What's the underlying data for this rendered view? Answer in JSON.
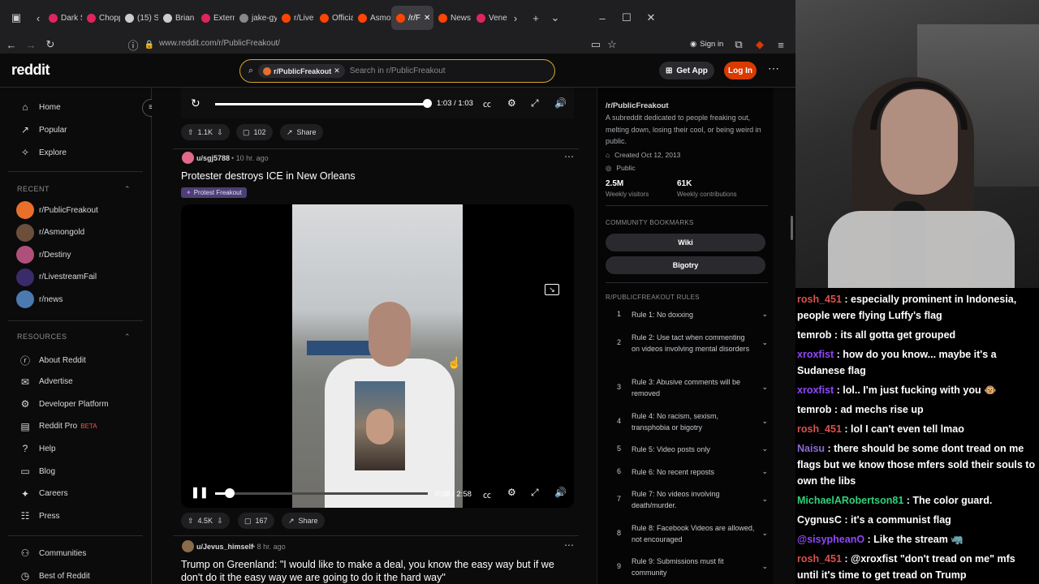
{
  "browser": {
    "tabs": [
      {
        "label": "Dark S",
        "color": "#e0245e"
      },
      {
        "label": "Chopp",
        "color": "#e0245e"
      },
      {
        "label": "(15) S",
        "color": "#cccccc"
      },
      {
        "label": "Brian",
        "color": "#cccccc"
      },
      {
        "label": "Extern",
        "color": "#e0245e"
      },
      {
        "label": "jake-gylle",
        "color": "#888888"
      },
      {
        "label": "r/Live",
        "color": "#ff4500"
      },
      {
        "label": "Officia",
        "color": "#ff4500"
      },
      {
        "label": "Asmo",
        "color": "#ff4500"
      },
      {
        "label": "/r/F",
        "color": "#ff4500"
      },
      {
        "label": "News",
        "color": "#ff4500"
      },
      {
        "label": "Vene",
        "color": "#e0245e"
      }
    ],
    "url": "www.reddit.com/r/PublicFreakout/",
    "sign_in": "Sign in"
  },
  "header": {
    "logo": "reddit",
    "search_chip": "r/PublicFreakout",
    "search_placeholder": "Search in r/PublicFreakout",
    "get_app": "Get App",
    "log_in": "Log In"
  },
  "sidebar": {
    "nav": [
      {
        "label": "Home",
        "icon": "home-icon"
      },
      {
        "label": "Popular",
        "icon": "popular-icon"
      },
      {
        "label": "Explore",
        "icon": "explore-icon"
      }
    ],
    "recent_title": "RECENT",
    "recent": [
      {
        "label": "r/PublicFreakout",
        "color": "#e8702a"
      },
      {
        "label": "r/Asmongold",
        "color": "#6b4f3a"
      },
      {
        "label": "r/Destiny",
        "color": "#b0507a"
      },
      {
        "label": "r/LivestreamFail",
        "color": "#3a2b6b"
      },
      {
        "label": "r/news",
        "color": "#4a7ab0"
      }
    ],
    "resources_title": "RESOURCES",
    "resources": [
      {
        "label": "About Reddit"
      },
      {
        "label": "Advertise"
      },
      {
        "label": "Developer Platform"
      },
      {
        "label": "Reddit Pro",
        "badge": "BETA"
      },
      {
        "label": "Help"
      },
      {
        "label": "Blog"
      },
      {
        "label": "Careers"
      },
      {
        "label": "Press"
      }
    ],
    "bottom": [
      {
        "label": "Communities"
      },
      {
        "label": "Best of Reddit"
      }
    ]
  },
  "feed": {
    "top_video": {
      "time": "1:03 / 1:03",
      "progress": 1.0
    },
    "top_actions": {
      "votes": "1.1K",
      "comments": "102",
      "share": "Share"
    },
    "post1": {
      "user": "u/sgj5788",
      "age": "10 hr. ago",
      "title": "Protester destroys ICE in New Orleans",
      "flair": "Protest Freakout",
      "video_time": "0:08 / 2:58",
      "progress": 0.045,
      "votes": "4.5K",
      "comments": "167",
      "share": "Share"
    },
    "post2": {
      "user": "u/Jevus_himself",
      "age": "8 hr. ago",
      "title_line1": "Trump on Greenland: \"I would like to make a deal, you know the easy way but if we",
      "title_line2": "don't do it the easy way we are going to do it the hard way\""
    }
  },
  "about": {
    "name": "/r/PublicFreakout",
    "description": "A subreddit dedicated to people freaking out, melting down, losing their cool, or being weird in public.",
    "created": "Created Oct 12, 2013",
    "visibility": "Public",
    "stat1_value": "2.5M",
    "stat1_label": "Weekly visitors",
    "stat2_value": "61K",
    "stat2_label": "Weekly contributions",
    "bookmarks_title": "COMMUNITY BOOKMARKS",
    "bookmarks": [
      "Wiki",
      "Bigotry"
    ],
    "rules_title": "R/PUBLICFREAKOUT RULES",
    "rules": [
      {
        "n": "1",
        "text": "Rule 1: No doxxing"
      },
      {
        "n": "2",
        "text": "Rule 2: Use tact when commenting on videos involving mental disorders"
      },
      {
        "n": "3",
        "text": "Rule 3: Abusive comments will be removed"
      },
      {
        "n": "4",
        "text": "Rule 4: No racism, sexism, transphobia or bigotry"
      },
      {
        "n": "5",
        "text": "Rule 5: Video posts only"
      },
      {
        "n": "6",
        "text": "Rule 6: No recent reposts"
      },
      {
        "n": "7",
        "text": "Rule 7: No videos involving death/murder."
      },
      {
        "n": "8",
        "text": "Rule 8: Facebook Videos are allowed, not encouraged"
      },
      {
        "n": "9",
        "text": "Rule 9: Submissions must fit community"
      }
    ]
  },
  "chat": [
    {
      "user": "rosh_451",
      "color": "#d9534f",
      "text": "especially prominent in Indonesia, people were flying Luffy's flag"
    },
    {
      "user": "temrob",
      "color": "#ffffff",
      "text": "its all gotta get grouped"
    },
    {
      "user": "xroxfist",
      "color": "#9146ff",
      "text": "how do you know... maybe it's a Sudanese flag"
    },
    {
      "user": "xroxfist",
      "color": "#9146ff",
      "text": "lol.. I'm just fucking with you 🐵"
    },
    {
      "user": "temrob",
      "color": "#ffffff",
      "text": "ad mechs rise up"
    },
    {
      "user": "rosh_451",
      "color": "#d9534f",
      "text": "lol I can't even tell lmao"
    },
    {
      "user": "Naisu",
      "color": "#8a6bd6",
      "text": "there should be some dont tread on me flags but we know those mfers sold their souls to own the libs"
    },
    {
      "user": "MichaelARobertson81",
      "color": "#2fd17a",
      "text": "The color guard."
    },
    {
      "user": "CygnusC",
      "color": "#ffffff",
      "text": "it's a communist flag"
    },
    {
      "user": "@sisypheanO",
      "color": "#9146ff",
      "text": "Like the stream 🦏"
    },
    {
      "user": "rosh_451",
      "color": "#d9534f",
      "text": "@xroxfist \"don't tread on me\" mfs until it's time to get tread on Trump"
    }
  ]
}
